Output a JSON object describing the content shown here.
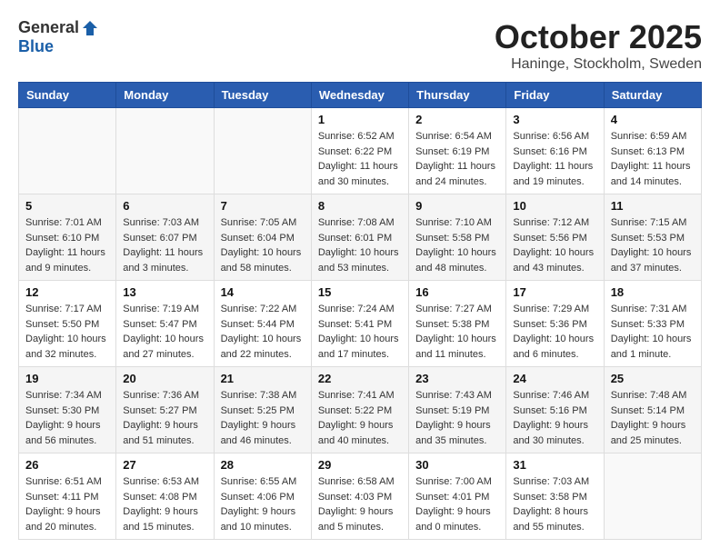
{
  "logo": {
    "general": "General",
    "blue": "Blue"
  },
  "header": {
    "month": "October 2025",
    "location": "Haninge, Stockholm, Sweden"
  },
  "weekdays": [
    "Sunday",
    "Monday",
    "Tuesday",
    "Wednesday",
    "Thursday",
    "Friday",
    "Saturday"
  ],
  "weeks": [
    [
      {
        "day": "",
        "info": ""
      },
      {
        "day": "",
        "info": ""
      },
      {
        "day": "",
        "info": ""
      },
      {
        "day": "1",
        "info": "Sunrise: 6:52 AM\nSunset: 6:22 PM\nDaylight: 11 hours\nand 30 minutes."
      },
      {
        "day": "2",
        "info": "Sunrise: 6:54 AM\nSunset: 6:19 PM\nDaylight: 11 hours\nand 24 minutes."
      },
      {
        "day": "3",
        "info": "Sunrise: 6:56 AM\nSunset: 6:16 PM\nDaylight: 11 hours\nand 19 minutes."
      },
      {
        "day": "4",
        "info": "Sunrise: 6:59 AM\nSunset: 6:13 PM\nDaylight: 11 hours\nand 14 minutes."
      }
    ],
    [
      {
        "day": "5",
        "info": "Sunrise: 7:01 AM\nSunset: 6:10 PM\nDaylight: 11 hours\nand 9 minutes."
      },
      {
        "day": "6",
        "info": "Sunrise: 7:03 AM\nSunset: 6:07 PM\nDaylight: 11 hours\nand 3 minutes."
      },
      {
        "day": "7",
        "info": "Sunrise: 7:05 AM\nSunset: 6:04 PM\nDaylight: 10 hours\nand 58 minutes."
      },
      {
        "day": "8",
        "info": "Sunrise: 7:08 AM\nSunset: 6:01 PM\nDaylight: 10 hours\nand 53 minutes."
      },
      {
        "day": "9",
        "info": "Sunrise: 7:10 AM\nSunset: 5:58 PM\nDaylight: 10 hours\nand 48 minutes."
      },
      {
        "day": "10",
        "info": "Sunrise: 7:12 AM\nSunset: 5:56 PM\nDaylight: 10 hours\nand 43 minutes."
      },
      {
        "day": "11",
        "info": "Sunrise: 7:15 AM\nSunset: 5:53 PM\nDaylight: 10 hours\nand 37 minutes."
      }
    ],
    [
      {
        "day": "12",
        "info": "Sunrise: 7:17 AM\nSunset: 5:50 PM\nDaylight: 10 hours\nand 32 minutes."
      },
      {
        "day": "13",
        "info": "Sunrise: 7:19 AM\nSunset: 5:47 PM\nDaylight: 10 hours\nand 27 minutes."
      },
      {
        "day": "14",
        "info": "Sunrise: 7:22 AM\nSunset: 5:44 PM\nDaylight: 10 hours\nand 22 minutes."
      },
      {
        "day": "15",
        "info": "Sunrise: 7:24 AM\nSunset: 5:41 PM\nDaylight: 10 hours\nand 17 minutes."
      },
      {
        "day": "16",
        "info": "Sunrise: 7:27 AM\nSunset: 5:38 PM\nDaylight: 10 hours\nand 11 minutes."
      },
      {
        "day": "17",
        "info": "Sunrise: 7:29 AM\nSunset: 5:36 PM\nDaylight: 10 hours\nand 6 minutes."
      },
      {
        "day": "18",
        "info": "Sunrise: 7:31 AM\nSunset: 5:33 PM\nDaylight: 10 hours\nand 1 minute."
      }
    ],
    [
      {
        "day": "19",
        "info": "Sunrise: 7:34 AM\nSunset: 5:30 PM\nDaylight: 9 hours\nand 56 minutes."
      },
      {
        "day": "20",
        "info": "Sunrise: 7:36 AM\nSunset: 5:27 PM\nDaylight: 9 hours\nand 51 minutes."
      },
      {
        "day": "21",
        "info": "Sunrise: 7:38 AM\nSunset: 5:25 PM\nDaylight: 9 hours\nand 46 minutes."
      },
      {
        "day": "22",
        "info": "Sunrise: 7:41 AM\nSunset: 5:22 PM\nDaylight: 9 hours\nand 40 minutes."
      },
      {
        "day": "23",
        "info": "Sunrise: 7:43 AM\nSunset: 5:19 PM\nDaylight: 9 hours\nand 35 minutes."
      },
      {
        "day": "24",
        "info": "Sunrise: 7:46 AM\nSunset: 5:16 PM\nDaylight: 9 hours\nand 30 minutes."
      },
      {
        "day": "25",
        "info": "Sunrise: 7:48 AM\nSunset: 5:14 PM\nDaylight: 9 hours\nand 25 minutes."
      }
    ],
    [
      {
        "day": "26",
        "info": "Sunrise: 6:51 AM\nSunset: 4:11 PM\nDaylight: 9 hours\nand 20 minutes."
      },
      {
        "day": "27",
        "info": "Sunrise: 6:53 AM\nSunset: 4:08 PM\nDaylight: 9 hours\nand 15 minutes."
      },
      {
        "day": "28",
        "info": "Sunrise: 6:55 AM\nSunset: 4:06 PM\nDaylight: 9 hours\nand 10 minutes."
      },
      {
        "day": "29",
        "info": "Sunrise: 6:58 AM\nSunset: 4:03 PM\nDaylight: 9 hours\nand 5 minutes."
      },
      {
        "day": "30",
        "info": "Sunrise: 7:00 AM\nSunset: 4:01 PM\nDaylight: 9 hours\nand 0 minutes."
      },
      {
        "day": "31",
        "info": "Sunrise: 7:03 AM\nSunset: 3:58 PM\nDaylight: 8 hours\nand 55 minutes."
      },
      {
        "day": "",
        "info": ""
      }
    ]
  ]
}
